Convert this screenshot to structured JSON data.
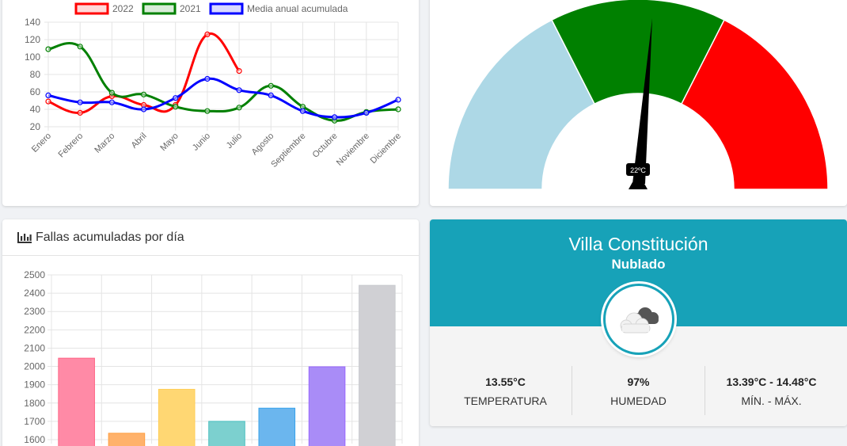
{
  "line_chart": {
    "chart_data": {
      "type": "line",
      "categories": [
        "Enero",
        "Febrero",
        "Marzo",
        "Abril",
        "Mayo",
        "Junio",
        "Julio",
        "Agosto",
        "Septiembre",
        "Octubre",
        "Noviembre",
        "Diciembre"
      ],
      "series": [
        {
          "name": "2022",
          "color": "#ff0000",
          "values": [
            49,
            36,
            55,
            45,
            45,
            126,
            84,
            null,
            null,
            null,
            null,
            null
          ]
        },
        {
          "name": "2021",
          "color": "#008000",
          "values": [
            109,
            112,
            59,
            57,
            43,
            38,
            42,
            67,
            43,
            27,
            37,
            40
          ]
        },
        {
          "name": "Media anual acumulada",
          "color": "#0000ff",
          "values": [
            56,
            48,
            48,
            40,
            53,
            75,
            62,
            56,
            38,
            31,
            36,
            51
          ]
        }
      ],
      "y_ticks": [
        20,
        40,
        60,
        80,
        100,
        120,
        140
      ],
      "ylim": [
        20,
        140
      ],
      "grid": true,
      "legend": "top"
    }
  },
  "gauge": {
    "label": "22ºC",
    "colors": {
      "cold": "#add8e6",
      "normal": "#008000",
      "hot": "#ff0000",
      "needle": "#000000"
    }
  },
  "bar_chart": {
    "title": "Fallas acumuladas por día",
    "title_icon": "bar-chart-icon",
    "chart_data": {
      "type": "bar",
      "values": [
        2045,
        1635,
        1875,
        1700,
        1772,
        1998,
        2443
      ],
      "colors": [
        "#ff8aa6",
        "#ffb26b",
        "#ffd773",
        "#7cd0cf",
        "#6bb6ee",
        "#a98cf7",
        "#d0d0d4"
      ],
      "borders": [
        "#ff6384",
        "#ff9f40",
        "#ffcd56",
        "#4bc0c0",
        "#36a2eb",
        "#9966ff",
        "#c9cbcf"
      ],
      "y_ticks": [
        1600,
        1700,
        1800,
        1900,
        2000,
        2100,
        2200,
        2300,
        2400,
        2500
      ],
      "ylim": [
        1600,
        2500
      ],
      "grid": true
    }
  },
  "weather": {
    "city": "Villa Constitución",
    "condition": "Nublado",
    "icon": "cloudy-icon",
    "stats": [
      {
        "value": "13.55°C",
        "label": "TEMPERATURA"
      },
      {
        "value": "97%",
        "label": "HUMEDAD"
      },
      {
        "value": "13.39°C - 14.48°C",
        "label": "MÍN. - MÁX."
      }
    ]
  }
}
